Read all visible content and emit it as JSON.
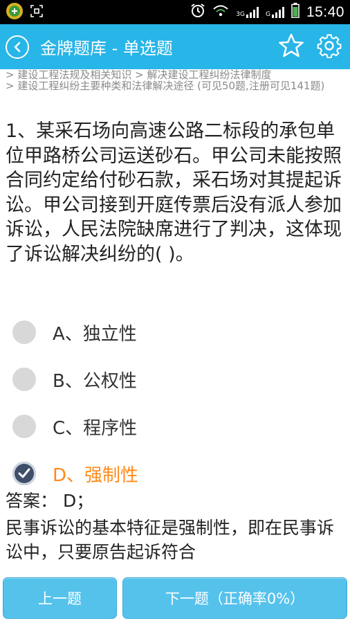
{
  "status_bar": {
    "time": "15:40",
    "network1": "3G",
    "network2": "G"
  },
  "header": {
    "title": "金牌题库  -  单选题"
  },
  "breadcrumb": {
    "line1": "> 建设工程法规及相关知识 > 解决建设工程纠纷法律制度",
    "line2": "> 建设工程纠纷主要种类和法律解决途径 (可见50题,注册可见141题)"
  },
  "question": {
    "text": "1、某采石场向高速公路二标段的承包单位甲路桥公司运送砂石。甲公司未能按照合同约定给付砂石款，采石场对其提起诉讼。甲公司接到开庭传票后没有派人参加诉讼，人民法院缺席进行了判决，这体现了诉讼解决纠纷的( )。"
  },
  "options": [
    {
      "label": "A、独立性",
      "selected": false
    },
    {
      "label": "B、公权性",
      "selected": false
    },
    {
      "label": "C、程序性",
      "selected": false
    },
    {
      "label": "D、强制性",
      "selected": true
    }
  ],
  "answer": {
    "label": "答案： D；",
    "explanation": "民事诉讼的基本特征是强制性，即在民事诉讼中，只要原告起诉符合"
  },
  "buttons": {
    "prev": "上一题",
    "next": "下一题（正确率0%）"
  },
  "colors": {
    "accent": "#28b5e7",
    "button": "#55c2ec",
    "selected_option": "#ff8a1a"
  }
}
